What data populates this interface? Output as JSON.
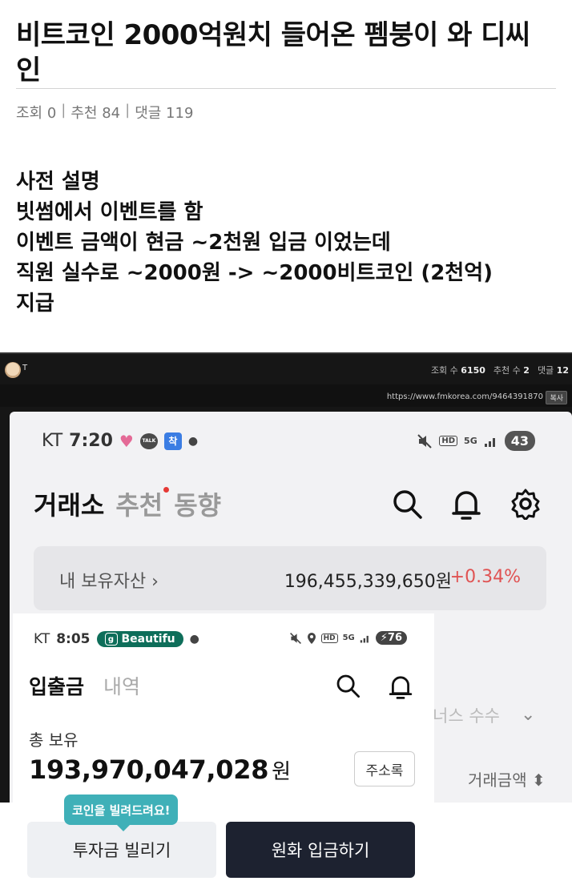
{
  "post": {
    "title": "비트코인 2000억원치 들어온 펨붕이 와 디씨인",
    "meta": {
      "views": "조회 0",
      "sep1": "|",
      "recommend": "추천 84",
      "sep2": "|",
      "comments": "댓글 119"
    },
    "body": [
      "사전 설명",
      "빗썸에서 이벤트를 함",
      "이벤트 금액이 현금 ~2천원 입금 이었는데",
      "직원 실수로 ~2000원 -> ~2000비트코인 (2천억)",
      "지급"
    ]
  },
  "screenshot_header": {
    "title_fragment": "T",
    "views_label": "조회 수",
    "views": "6150",
    "recommend_label": "추천 수",
    "recommend": "2",
    "comments_label": "댓글",
    "comments": "12",
    "url": "https://www.fmkorea.com/9464391870",
    "copy_label": "복사"
  },
  "phone1": {
    "carrier": "KT",
    "time": "7:20",
    "talk_badge": "TALK",
    "chak_badge": "착",
    "battery": "43",
    "nav": {
      "active": "거래소",
      "recommend": "추천",
      "trend": "동향"
    },
    "asset": {
      "label": "내 보유자산 ›",
      "amount": "196,455,339,650원",
      "change": "+0.34%"
    },
    "behind_text": {
      "fee": "너스 수수",
      "trade_amount": "거래금액 ⬍"
    }
  },
  "phone2": {
    "carrier": "KT",
    "time": "8:05",
    "pill_label": "Beautifu",
    "pill_icon": "g",
    "battery": "76",
    "nav": {
      "active": "입출금",
      "history": "내역"
    },
    "total_label": "총 보유",
    "total_amount": "193,970,047,028",
    "currency": "원",
    "address_book": "주소록"
  },
  "bottom": {
    "tooltip": "코인을 빌려드려요!",
    "borrow": "투자금 빌리기",
    "deposit": "원화 입금하기"
  },
  "colors": {
    "accent_red": "#e05353",
    "dark_button": "#1d2230",
    "teal_tooltip": "#3fb0b8",
    "pill_green": "#0e6e5a"
  }
}
